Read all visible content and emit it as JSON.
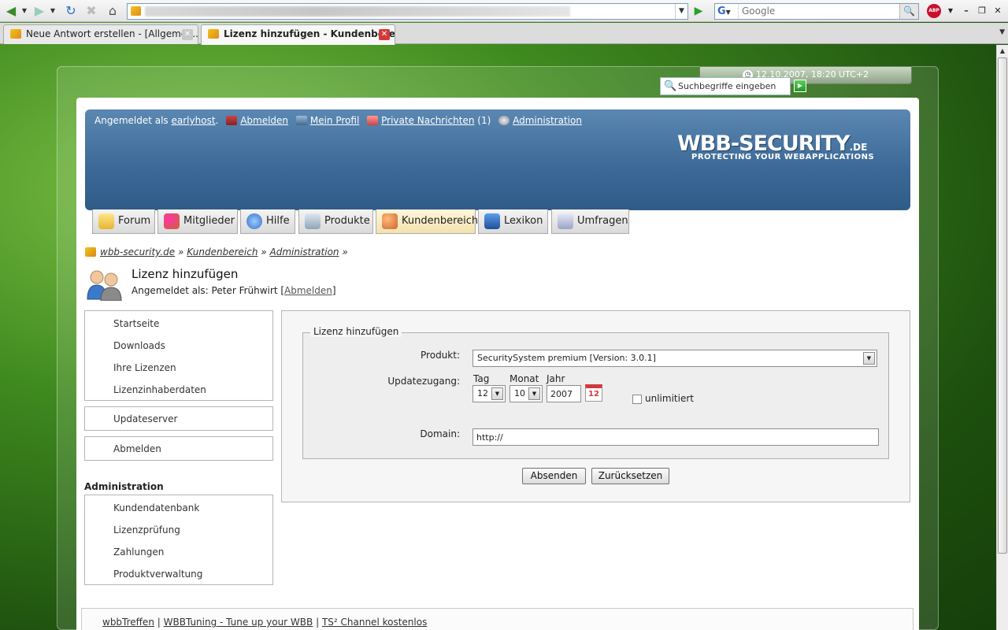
{
  "browser": {
    "search_placeholder": "Google",
    "abp_label": "ABP",
    "tabs": [
      {
        "label": "Neue Antwort erstellen - [Allgemei..."
      },
      {
        "label": "Lizenz hinzufügen - Kundenberei..."
      }
    ]
  },
  "clock": "12.10.2007, 18:20 UTC+2",
  "header": {
    "logged_prefix": "Angemeldet als",
    "username": "earlyhost",
    "logout": "Abmelden",
    "profile": "Mein Profil",
    "pm": "Private Nachrichten",
    "pm_count": "(1)",
    "admin": "Administration",
    "logo_main": "WBB-SECURITY",
    "logo_tld": ".DE",
    "logo_sub": "PROTECTING YOUR WEBAPPLICATIONS",
    "search_placeholder": "Suchbegriffe eingeben"
  },
  "nav": [
    "Forum",
    "Mitglieder",
    "Hilfe",
    "Produkte",
    "Kundenbereich",
    "Lexikon",
    "Umfragen"
  ],
  "breadcrumb": [
    "wbb-security.de",
    "Kundenbereich",
    "Administration"
  ],
  "page": {
    "title": "Lizenz hinzufügen",
    "logged_as": "Angemeldet als: Peter Frühwirt [",
    "logout_link": "Abmelden",
    "logged_as_end": "]"
  },
  "sidebar": {
    "group1": [
      "Startseite",
      "Downloads",
      "Ihre Lizenzen",
      "Lizenzinhaberdaten"
    ],
    "update": "Updateserver",
    "logout": "Abmelden",
    "admin_heading": "Administration",
    "admin_items": [
      "Kundendatenbank",
      "Lizenzprüfung",
      "Zahlungen",
      "Produktverwaltung"
    ]
  },
  "form": {
    "legend": "Lizenz hinzufügen",
    "product_label": "Produkt:",
    "product_value": "SecuritySystem premium [Version: 3.0.1]",
    "update_label": "Updatezugang:",
    "day_label": "Tag",
    "month_label": "Monat",
    "year_label": "Jahr",
    "day_value": "12",
    "month_value": "10",
    "year_value": "2007",
    "calendar_num": "12",
    "unlimited_label": "unlimitiert",
    "domain_label": "Domain:",
    "domain_value": "http://",
    "submit": "Absenden",
    "reset": "Zurücksetzen"
  },
  "footer": [
    "wbbTreffen",
    "WBBTuning - Tune up your WBB",
    "TS² Channel kostenlos"
  ]
}
